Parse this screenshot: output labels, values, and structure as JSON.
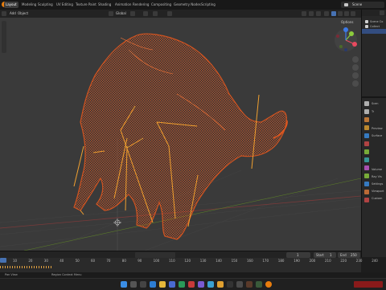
{
  "workspace_tabs": [
    "Layout",
    "Modeling",
    "Sculpting",
    "UV Editing",
    "Texture Paint",
    "Shading",
    "Animation",
    "Rendering",
    "Compositing",
    "Geometry Nodes",
    "Scripting"
  ],
  "scene_name": "Scene",
  "header": {
    "menu_add": "Add",
    "menu_object": "Object",
    "transform_orientation": "Global",
    "options_label": "Options"
  },
  "outliner": {
    "rows": [
      "Scene Co",
      "Collect",
      ""
    ]
  },
  "properties": {
    "rows": [
      "Scen",
      "Tr",
      "Preview",
      "Surface",
      "Volume",
      "Ray Vis",
      "Settings",
      "Viewport",
      "Custom"
    ]
  },
  "timeline": {
    "current_frame": "1",
    "start_label": "Start",
    "start_value": "1",
    "end_label": "End",
    "end_value": "250",
    "ticks": [
      "10",
      "20",
      "30",
      "40",
      "50",
      "60",
      "70",
      "80",
      "90",
      "100",
      "110",
      "120",
      "130",
      "140",
      "150",
      "160",
      "170",
      "180",
      "190",
      "200",
      "210",
      "220",
      "230",
      "240",
      "250"
    ]
  },
  "status": {
    "left": "Pan View",
    "right": "Region Context Menu"
  },
  "colors": {
    "wire": "#e2571f",
    "bone": "#f0a030",
    "accent_tab": "#3d3d3d",
    "grid_red_axis": "#7a3a3a",
    "grid_green_axis": "#5a7a2a",
    "gizmo_x": "#e84a5f",
    "gizmo_y": "#8ccc3c",
    "gizmo_z": "#3c7ae8"
  }
}
